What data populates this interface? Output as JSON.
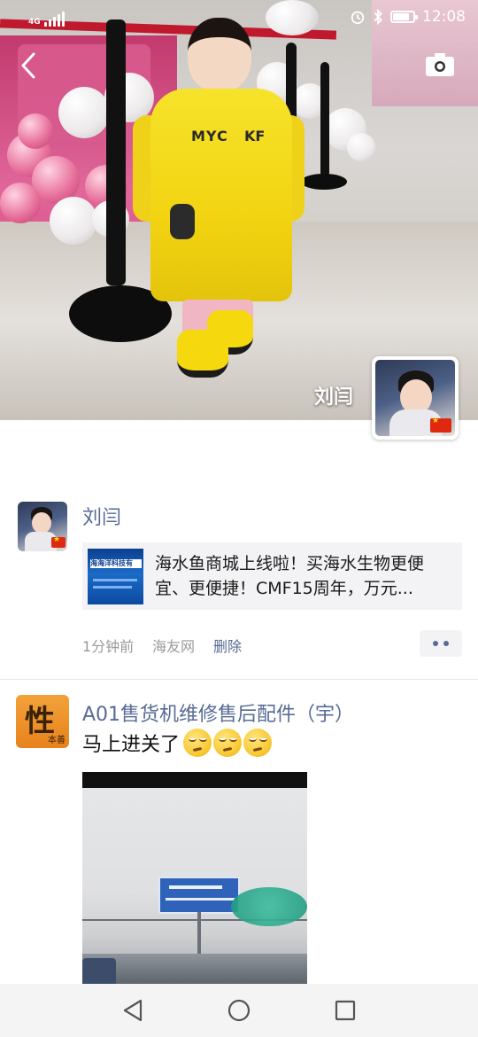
{
  "status_bar": {
    "network": "4G",
    "time": "12:08",
    "icons": [
      "signal-icon",
      "alarm-icon",
      "bluetooth-icon",
      "battery-icon"
    ],
    "battery_level": 0.8
  },
  "header": {
    "back_icon": "back-arrow-icon",
    "camera_icon": "camera-icon",
    "owner_name": "刘闫"
  },
  "posts": [
    {
      "author": "刘闫",
      "link": {
        "text": "海水鱼商城上线啦！买海水生物更便宜、更便捷！CMF15周年，万元...",
        "thumb_title": "海海洋科技有"
      },
      "time": "1分钟前",
      "source": "海友网",
      "delete_label": "删除"
    },
    {
      "author": "A01售货机维修售后配件（宇）",
      "avatar_text": "性",
      "avatar_subtext": "本善",
      "text": "马上进关了",
      "emoji_count": 3,
      "emoji_icon": "smirk-emoji-icon"
    }
  ],
  "nav_bar": {
    "icons": [
      "back-triangle-icon",
      "home-circle-icon",
      "recents-square-icon"
    ]
  },
  "colors": {
    "name_link": "#576b95",
    "meta_gray": "#9a9a9a",
    "card_bg": "#f3f3f5"
  }
}
